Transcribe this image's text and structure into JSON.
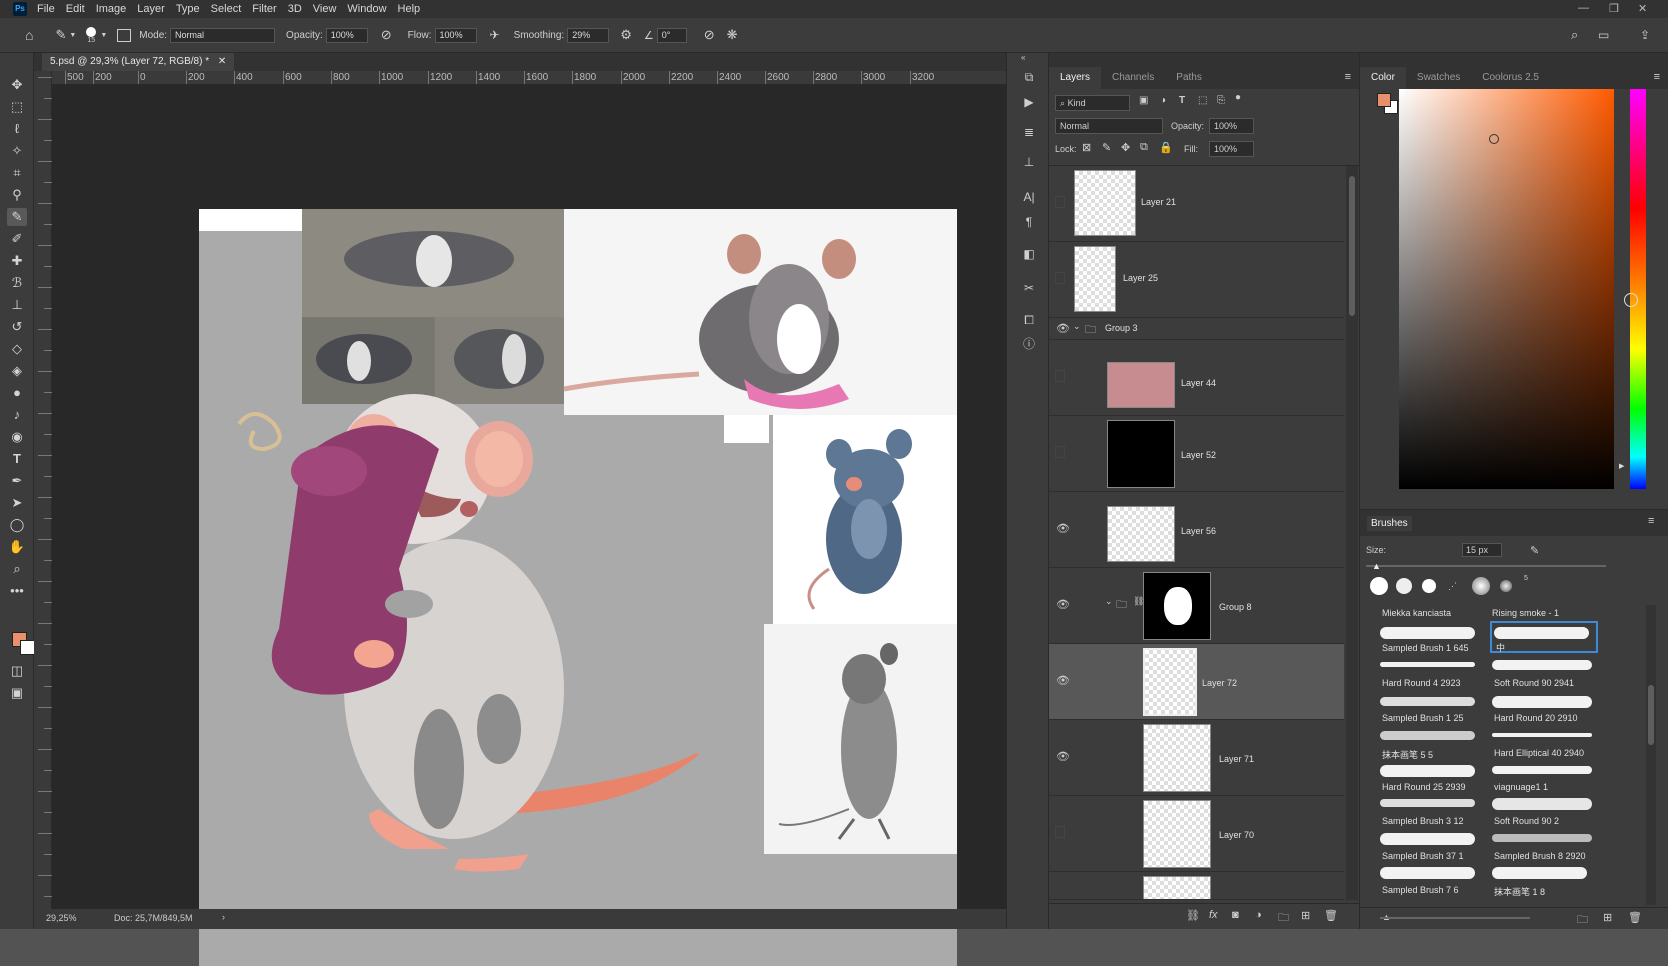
{
  "menubar": {
    "logo": "Ps",
    "items": [
      "File",
      "Edit",
      "Image",
      "Layer",
      "Type",
      "Select",
      "Filter",
      "3D",
      "View",
      "Window",
      "Help"
    ]
  },
  "options": {
    "brush_size": "15",
    "mode_label": "Mode:",
    "mode_value": "Normal",
    "opacity_label": "Opacity:",
    "opacity_value": "100%",
    "flow_label": "Flow:",
    "flow_value": "100%",
    "smoothing_label": "Smoothing:",
    "smoothing_value": "29%",
    "angle_value": "0°"
  },
  "document": {
    "tab_title": "5.psd @ 29,3% (Layer 72, RGB/8) *",
    "ruler_ticks": [
      "500",
      "200",
      "0",
      "200",
      "400",
      "600",
      "800",
      "1000",
      "1200",
      "1400",
      "1600",
      "1800",
      "2000",
      "2200",
      "2400",
      "2600",
      "2800",
      "3000",
      "3200"
    ],
    "zoom": "29,25%",
    "doc_size": "Doc: 25,7M/849,5M"
  },
  "layers_panel": {
    "tabs": [
      "Layers",
      "Channels",
      "Paths"
    ],
    "filter_kind": "Kind",
    "blend_mode": "Normal",
    "opacity_label": "Opacity:",
    "opacity_value": "100%",
    "lock_label": "Lock:",
    "fill_label": "Fill:",
    "fill_value": "100%",
    "layers": [
      {
        "name": "Layer 21",
        "visible": false
      },
      {
        "name": "Layer 25",
        "visible": false
      },
      {
        "name": "Group 3",
        "visible": true
      },
      {
        "name": "Layer 44",
        "visible": false
      },
      {
        "name": "Layer 52",
        "visible": false
      },
      {
        "name": "Layer 56",
        "visible": true
      },
      {
        "name": "Group 8",
        "visible": true
      },
      {
        "name": "Layer 72",
        "visible": true
      },
      {
        "name": "Layer 71",
        "visible": true
      },
      {
        "name": "Layer 70",
        "visible": false
      }
    ]
  },
  "color_panel": {
    "tabs": [
      "Color",
      "Swatches",
      "Coolorus 2.5"
    ],
    "foreground": "#e8906e",
    "background": "#ffffff",
    "hue_color": "#ff5a00"
  },
  "brushes_panel": {
    "title": "Brushes",
    "size_label": "Size:",
    "size_value": "15 px",
    "preset_count": "5",
    "header_left": "Miekka kanciasta",
    "header_right": "Rising smoke - 1",
    "brushes_left": [
      "Sampled Brush 1 645",
      "Hard Round 4 2923",
      "Sampled Brush 1 25",
      "抹本画笔 5 5",
      "Hard Round 25 2939",
      "Sampled Brush 3 12",
      "Sampled Brush 37 1",
      "Sampled Brush 7 6"
    ],
    "brushes_right": [
      "中",
      "Soft Round 90 2941",
      "Hard Round 20 2910",
      "Hard Elliptical 40 2940",
      "viagnuage1 1",
      "Soft Round 90 2",
      "Sampled Brush 8 2920",
      "抹本画笔 1 8"
    ]
  }
}
